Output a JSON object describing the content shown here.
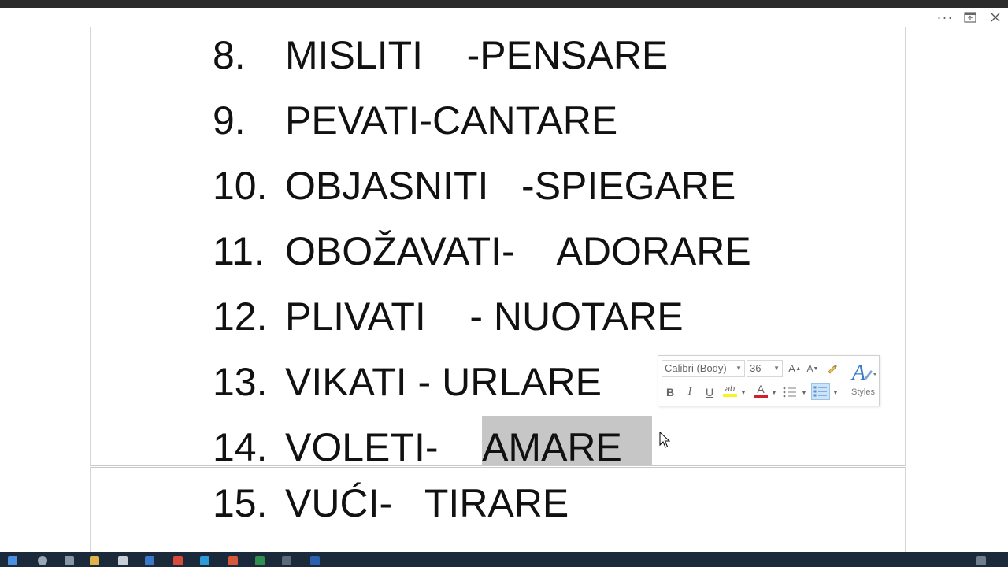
{
  "document": {
    "lines": [
      {
        "num": "8.",
        "text": "MISLITI    -PENSARE"
      },
      {
        "num": "9.",
        "text": "PEVATI-CANTARE"
      },
      {
        "num": "10.",
        "text": "OBJASNITI   -SPIEGARE"
      },
      {
        "num": "11.",
        "text": "OBOŽAVATI-    ADORARE"
      },
      {
        "num": "12.",
        "text": "PLIVATI    - NUOTARE"
      },
      {
        "num": "13.",
        "text": "VIKATI - URLARE"
      },
      {
        "num": "14.",
        "text": "VOLETI-    ",
        "selected": "AMARE"
      },
      {
        "num": "15.",
        "text": "VUĆI-   TIRARE"
      }
    ]
  },
  "mini_toolbar": {
    "font_name": "Calibri (Body)",
    "font_size": "36",
    "grow_font": "A",
    "shrink_font": "A",
    "bold": "B",
    "italic": "I",
    "underline": "U",
    "highlight": "ab",
    "font_color_letter": "A",
    "styles_label": "Styles",
    "highlight_color": "#f7f32a",
    "font_color": "#d0202f"
  },
  "window": {
    "more_options": "···"
  }
}
